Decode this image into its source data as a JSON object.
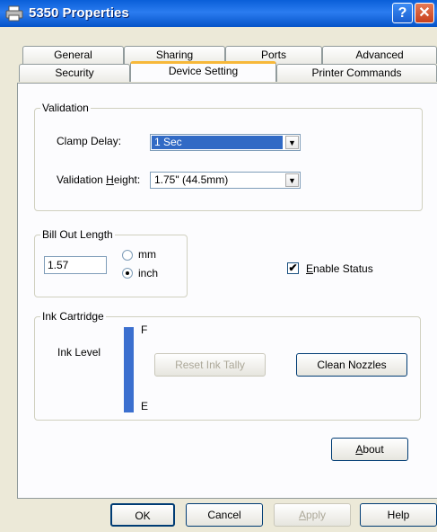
{
  "window": {
    "title": "5350 Properties",
    "help_glyph": "?",
    "close_glyph": "✕"
  },
  "tabs": {
    "row_back": [
      "General",
      "Sharing",
      "Ports",
      "Advanced"
    ],
    "row_front": [
      "Security",
      "Device Setting",
      "Printer Commands"
    ],
    "active": "Device Setting"
  },
  "validation": {
    "group_label": "Validation",
    "clamp_delay_label": "Clamp Delay:",
    "clamp_delay_value": "1 Sec",
    "height_label_prefix": "Validation ",
    "height_label_underlined": "H",
    "height_label_suffix": "eight:",
    "height_value": "1.75\" (44.5mm)"
  },
  "bill_out": {
    "group_label": "Bill Out Length",
    "value": "1.57",
    "unit_mm": "mm",
    "unit_inch": "inch",
    "selected_unit": "inch"
  },
  "enable_status": {
    "checked": true,
    "label_underlined": "E",
    "label_rest": "nable Status",
    "check_glyph": "✔"
  },
  "ink": {
    "group_label": "Ink Cartridge",
    "level_label": "Ink Level",
    "full_marker": "F",
    "empty_marker": "E",
    "level_fraction": 1.0,
    "reset_button": "Reset Ink Tally",
    "clean_button": "Clean Nozzles",
    "bar_color": "#3b6fcf"
  },
  "about_button": {
    "underlined": "A",
    "rest": "bout"
  },
  "footer": {
    "ok": "OK",
    "cancel": "Cancel",
    "apply_underlined": "A",
    "apply_rest": "pply",
    "help": "Help"
  },
  "colors": {
    "accent": "#0a5fd8",
    "tab_highlight": "#f7b83a",
    "selection": "#316ac5"
  }
}
